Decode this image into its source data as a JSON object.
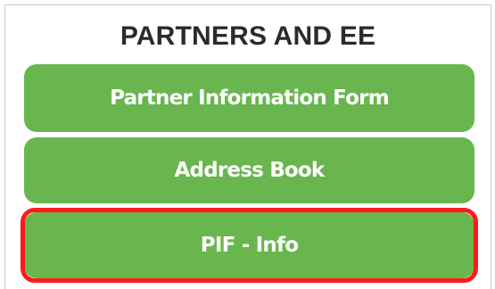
{
  "panel": {
    "title": "PARTNERS AND EE",
    "buttons": [
      {
        "label": "Partner Information Form"
      },
      {
        "label": "Address Book"
      },
      {
        "label": "PIF - Info"
      }
    ]
  },
  "colors": {
    "button_green": "#69b64f",
    "highlight_red": "#ff1a1a",
    "heading_text": "#2b2b2b"
  }
}
